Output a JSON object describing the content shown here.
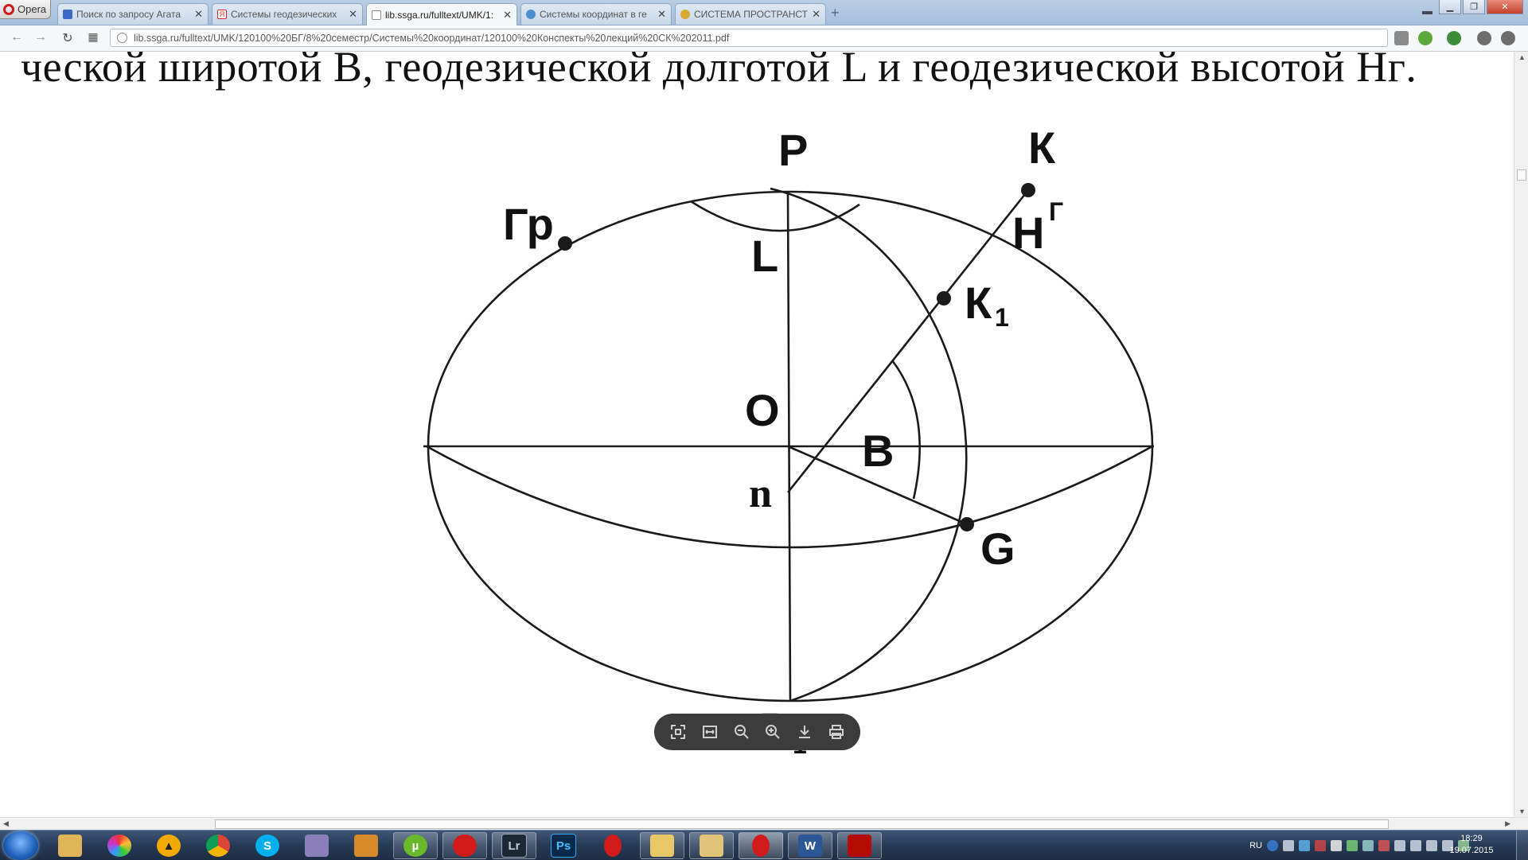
{
  "browser": {
    "menu_label": "Opera",
    "tabs": [
      {
        "label": "Поиск по запросу Агата",
        "favicon_color": "#3b67c7"
      },
      {
        "label": "Системы геодезических",
        "favicon_color": "#d92c2c"
      },
      {
        "label": "lib.ssga.ru/fulltext/UMK/1:",
        "favicon_color": "#888888"
      },
      {
        "label": "Системы координат в ге",
        "favicon_color": "#4b8fd0"
      },
      {
        "label": "СИСТЕМА ПРОСТРАНСТВ",
        "favicon_color": "#d8a830"
      }
    ],
    "active_tab_index": 2,
    "new_tab_symbol": "+",
    "url": "lib.ssga.ru/fulltext/UMK/120100%20БГ/8%20семестр/Системы%20координат/120100%20Конспекты%20лекций%20СК%202011.pdf"
  },
  "document": {
    "text_line": "ческой широтой B, геодезической долготой L и геодезической высотой Hᴦ.",
    "figure_labels": {
      "P": "P",
      "K": "К",
      "Gr": "Гр",
      "H": "H",
      "H_sup": "Г",
      "L": "L",
      "K1": "К",
      "K1_sub": "1",
      "O": "O",
      "B": "B",
      "n": "n",
      "G": "G",
      "P1": "P",
      "P1_sub": "1"
    }
  },
  "pdf_toolbar": {
    "buttons": [
      "fit-page",
      "fit-width",
      "zoom-out",
      "zoom-in",
      "download",
      "print"
    ]
  },
  "taskbar": {
    "apps": [
      {
        "name": "start-orb"
      },
      {
        "name": "libraries"
      },
      {
        "name": "picasa"
      },
      {
        "name": "aimp"
      },
      {
        "name": "chrome"
      },
      {
        "name": "skype"
      },
      {
        "name": "save-disk"
      },
      {
        "name": "ebook"
      },
      {
        "name": "utorrent"
      },
      {
        "name": "acronis"
      },
      {
        "name": "lightroom",
        "text": "Lr"
      },
      {
        "name": "photoshop",
        "text": "Ps"
      },
      {
        "name": "opera"
      },
      {
        "name": "folder"
      },
      {
        "name": "explorer"
      },
      {
        "name": "opera-active"
      },
      {
        "name": "word",
        "text": "W"
      },
      {
        "name": "acrobat"
      }
    ],
    "language": "RU",
    "time": "18:29",
    "date": "19.07.2015"
  }
}
